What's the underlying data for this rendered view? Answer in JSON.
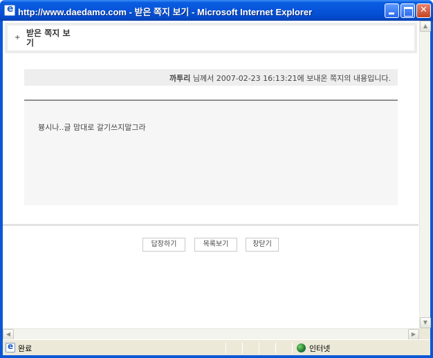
{
  "window": {
    "title": "http://www.daedamo.com - 받은 쪽지 보기 - Microsoft Internet Explorer"
  },
  "header": {
    "plus": "+",
    "title": "받은 쪽지 보기"
  },
  "message": {
    "sender": "까투리",
    "info_rest": " 님께서 2007-02-23 16:13:21에 보내온 쪽지의 내용입니다.",
    "body": "븅시나..글 맘대로 갈기쓰지말그라"
  },
  "buttons": {
    "reply": "답장하기",
    "list": "목록보기",
    "close": "창닫기"
  },
  "statusbar": {
    "status": "완료",
    "zone": "인터넷"
  },
  "colors": {
    "titlebar": "#0654da",
    "info_bg": "#eeeeee",
    "message_bg": "#f6f6f6"
  }
}
